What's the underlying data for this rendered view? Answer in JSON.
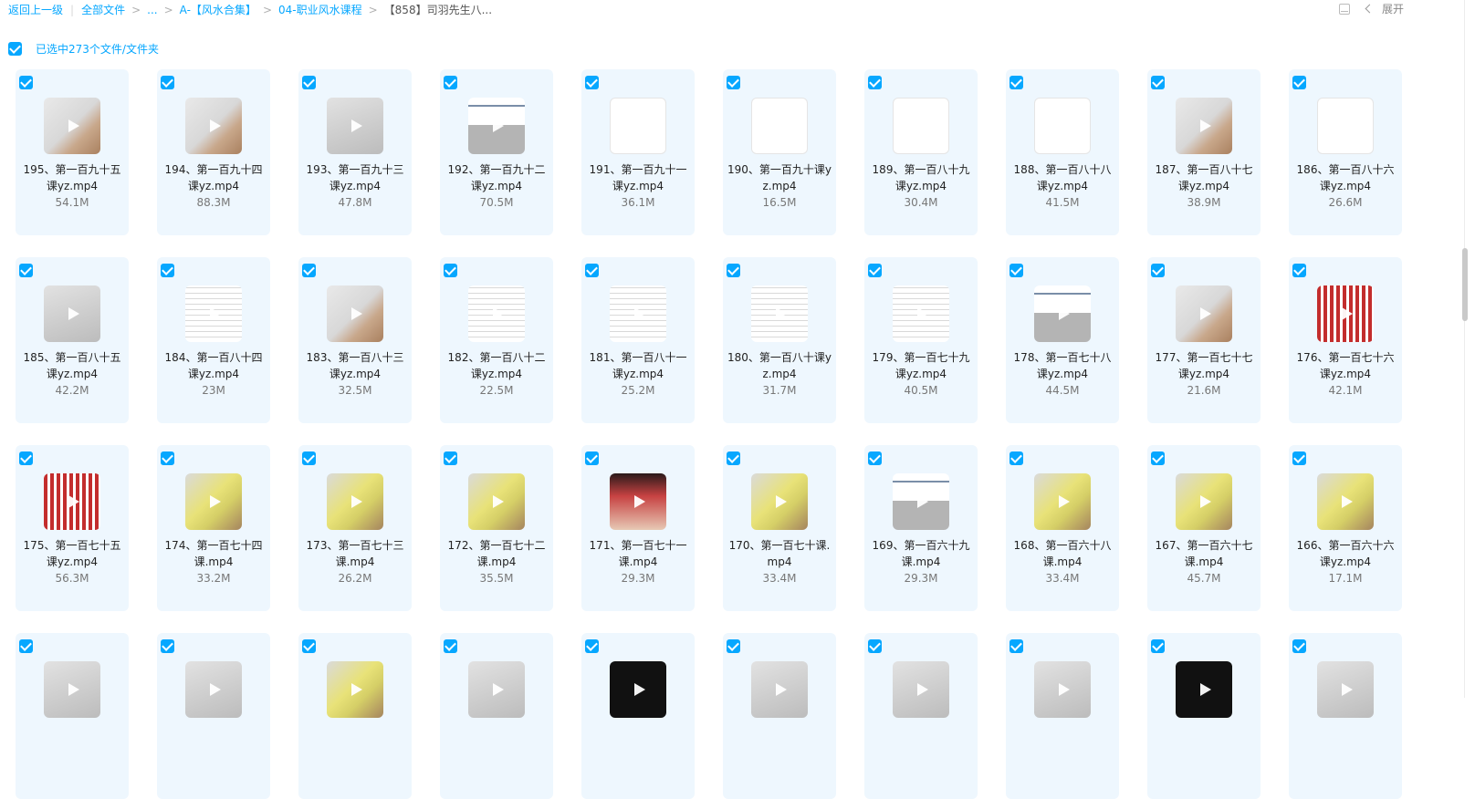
{
  "breadcrumb": {
    "back": "返回上一级",
    "all_files": "全部文件",
    "ellipsis": "...",
    "level1": "A-【风水合集】",
    "level2": "04-职业风水课程",
    "current": "【858】司羽先生八..."
  },
  "toolbar": {
    "expand_label": "展开"
  },
  "selection": {
    "label": "已选中273个文件/文件夹"
  },
  "files": [
    {
      "name": "195、第一百九十五课yz.mp4",
      "size": "54.1M",
      "thumb": "t-hand"
    },
    {
      "name": "194、第一百九十四课yz.mp4",
      "size": "88.3M",
      "thumb": "t-hand"
    },
    {
      "name": "193、第一百九十三课yz.mp4",
      "size": "47.8M",
      "thumb": "t-grey"
    },
    {
      "name": "192、第一百九十二课yz.mp4",
      "size": "70.5M",
      "thumb": "t-doc"
    },
    {
      "name": "191、第一百九十一课yz.mp4",
      "size": "36.1M",
      "thumb": "t-diagram"
    },
    {
      "name": "190、第一百九十课yz.mp4",
      "size": "16.5M",
      "thumb": "t-diagram"
    },
    {
      "name": "189、第一百八十九课yz.mp4",
      "size": "30.4M",
      "thumb": "t-diagram"
    },
    {
      "name": "188、第一百八十八课yz.mp4",
      "size": "41.5M",
      "thumb": "t-diagram"
    },
    {
      "name": "187、第一百八十七课yz.mp4",
      "size": "38.9M",
      "thumb": "t-hand"
    },
    {
      "name": "186、第一百八十六课yz.mp4",
      "size": "26.6M",
      "thumb": "t-diagram"
    },
    {
      "name": "185、第一百八十五课yz.mp4",
      "size": "42.2M",
      "thumb": "t-grey"
    },
    {
      "name": "184、第一百八十四课yz.mp4",
      "size": "23M",
      "thumb": "t-paper"
    },
    {
      "name": "183、第一百八十三课yz.mp4",
      "size": "32.5M",
      "thumb": "t-hand"
    },
    {
      "name": "182、第一百八十二课yz.mp4",
      "size": "22.5M",
      "thumb": "t-paper"
    },
    {
      "name": "181、第一百八十一课yz.mp4",
      "size": "25.2M",
      "thumb": "t-paper"
    },
    {
      "name": "180、第一百八十课yz.mp4",
      "size": "31.7M",
      "thumb": "t-paper"
    },
    {
      "name": "179、第一百七十九课yz.mp4",
      "size": "40.5M",
      "thumb": "t-paper"
    },
    {
      "name": "178、第一百七十八课yz.mp4",
      "size": "44.5M",
      "thumb": "t-doc"
    },
    {
      "name": "177、第一百七十七课yz.mp4",
      "size": "21.6M",
      "thumb": "t-hand"
    },
    {
      "name": "176、第一百七十六课yz.mp4",
      "size": "42.1M",
      "thumb": "t-red"
    },
    {
      "name": "175、第一百七十五课yz.mp4",
      "size": "56.3M",
      "thumb": "t-red"
    },
    {
      "name": "174、第一百七十四课.mp4",
      "size": "33.2M",
      "thumb": "t-yellow"
    },
    {
      "name": "173、第一百七十三课.mp4",
      "size": "26.2M",
      "thumb": "t-yellow"
    },
    {
      "name": "172、第一百七十二课.mp4",
      "size": "35.5M",
      "thumb": "t-yellow"
    },
    {
      "name": "171、第一百七十一课.mp4",
      "size": "29.3M",
      "thumb": "t-book"
    },
    {
      "name": "170、第一百七十课.mp4",
      "size": "33.4M",
      "thumb": "t-yellow"
    },
    {
      "name": "169、第一百六十九课.mp4",
      "size": "29.3M",
      "thumb": "t-doc"
    },
    {
      "name": "168、第一百六十八课.mp4",
      "size": "33.4M",
      "thumb": "t-yellow"
    },
    {
      "name": "167、第一百六十七课.mp4",
      "size": "45.7M",
      "thumb": "t-yellow"
    },
    {
      "name": "166、第一百六十六课yz.mp4",
      "size": "17.1M",
      "thumb": "t-yellow"
    },
    {
      "name": "",
      "size": "",
      "thumb": "t-grey"
    },
    {
      "name": "",
      "size": "",
      "thumb": "t-grey"
    },
    {
      "name": "",
      "size": "",
      "thumb": "t-yellow"
    },
    {
      "name": "",
      "size": "",
      "thumb": "t-grey"
    },
    {
      "name": "",
      "size": "",
      "thumb": "t-black"
    },
    {
      "name": "",
      "size": "",
      "thumb": "t-grey"
    },
    {
      "name": "",
      "size": "",
      "thumb": "t-grey"
    },
    {
      "name": "",
      "size": "",
      "thumb": "t-grey"
    },
    {
      "name": "",
      "size": "",
      "thumb": "t-black"
    },
    {
      "name": "",
      "size": "",
      "thumb": "t-grey"
    }
  ]
}
